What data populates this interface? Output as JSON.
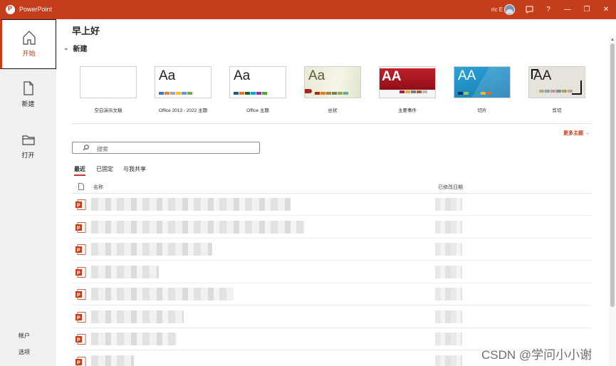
{
  "app": {
    "title": "PowerPoint",
    "user_name": "ric E"
  },
  "titlebar_buttons": {
    "help": "?",
    "minimize": "—",
    "restore": "❐",
    "close": "✕"
  },
  "sidebar": {
    "items": [
      {
        "label": "开始",
        "icon": "home-icon"
      },
      {
        "label": "新建",
        "icon": "new-file-icon"
      },
      {
        "label": "打开",
        "icon": "folder-icon"
      }
    ],
    "bottom": {
      "account": "帐户",
      "options": "选项"
    }
  },
  "main": {
    "greeting": "早上好",
    "new_section": "新建",
    "templates": [
      {
        "label": "空白演示文稿"
      },
      {
        "label": "Office 2013 - 2022 主题"
      },
      {
        "label": "Office 主题"
      },
      {
        "label": "丝状"
      },
      {
        "label": "主要事件"
      },
      {
        "label": "切片"
      },
      {
        "label": "剪切"
      }
    ],
    "more_themes": "更多主题 →",
    "search_placeholder": "搜索",
    "tabs": [
      "最近",
      "已固定",
      "与我共享"
    ],
    "file_list_header": {
      "name": "名称",
      "date": "已修改日期"
    }
  },
  "watermark": "CSDN @学问小小谢",
  "colors": {
    "accent": "#c43e1c",
    "sidebar_bg": "#f0f0f0"
  }
}
